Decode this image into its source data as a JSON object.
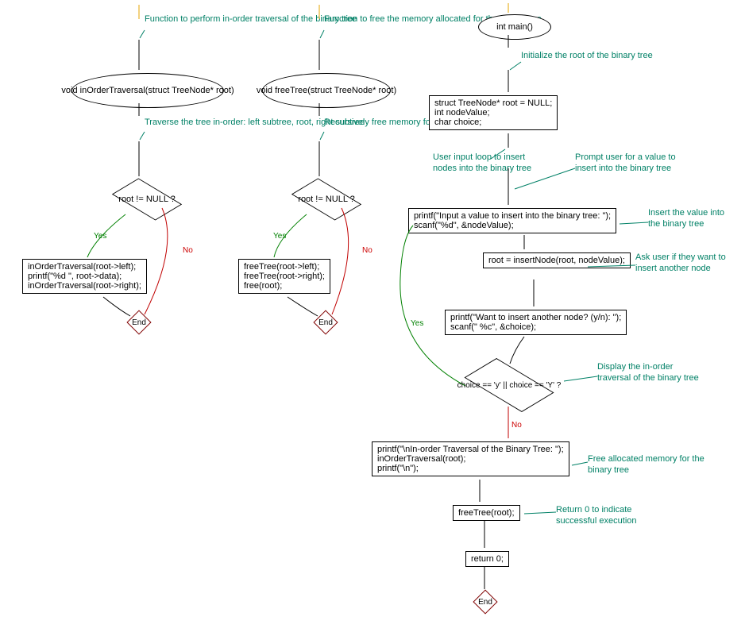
{
  "chart_data": [
    {
      "type": "flowchart",
      "title_comment": "Function to perform in-order traversal of the binary tree",
      "start": "void inOrderTraversal(struct TreeNode* root)",
      "step_comment": "Traverse the tree in-order: left subtree, root, right subtree",
      "decision": "root != NULL ?",
      "yes_branch": "inOrderTraversal(root->left);\nprintf(\"%d \", root->data);\ninOrderTraversal(root->right);",
      "end": "End"
    },
    {
      "type": "flowchart",
      "title_comment": "Function to free the memory allocated for the binary tree",
      "start": "void freeTree(struct TreeNode* root)",
      "step_comment": "Recursively free memory for the entire tree",
      "decision": "root != NULL ?",
      "yes_branch": "freeTree(root->left);\nfreeTree(root->right);\nfree(root);",
      "end": "End"
    },
    {
      "type": "flowchart",
      "start": "int main()",
      "init_comment": "Initialize the root of the binary tree",
      "init": "struct TreeNode* root = NULL;\nint nodeValue;\nchar choice;",
      "loop_comment": "User input loop to insert nodes into the binary tree",
      "prompt_comment": "Prompt user for a value to insert into the binary tree",
      "prompt": "printf(\"Input a value to insert into the binary tree: \");\nscanf(\"%d\", &nodeValue);",
      "insert_comment": "Insert the value into the binary tree",
      "insert": "root = insertNode(root, nodeValue);",
      "ask_comment": "Ask user if they want to insert another node",
      "ask": "printf(\"Want to insert another node? (y/n): \");\nscanf(\" %c\", &choice);",
      "decision": "choice == 'y' || choice == 'Y' ?",
      "display_comment": "Display the in-order traversal of the binary tree",
      "display": "printf(\"\\nIn-order Traversal of the Binary Tree: \");\ninOrderTraversal(root);\nprintf(\"\\n\");",
      "free_comment": "Free allocated memory for the binary tree",
      "free": "freeTree(root);",
      "return_comment": "Return 0 to indicate successful execution",
      "return": "return 0;",
      "end": "End"
    }
  ],
  "labels": {
    "yes": "Yes",
    "no": "No"
  }
}
